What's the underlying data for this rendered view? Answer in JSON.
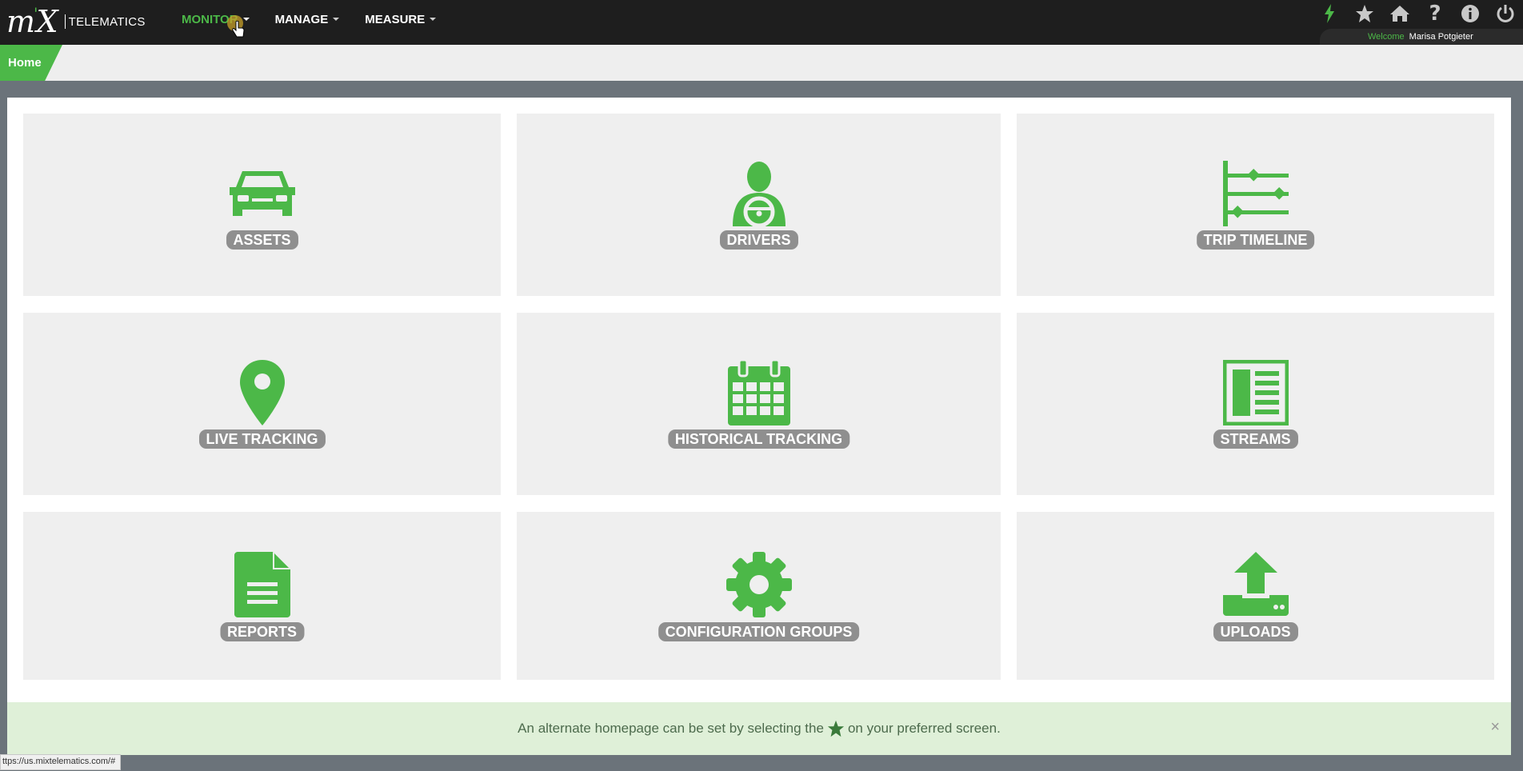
{
  "brand": {
    "logo": "m X",
    "product": "TELEMATICS"
  },
  "nav": {
    "menu": [
      {
        "label": "MONITOR",
        "active": true
      },
      {
        "label": "MANAGE",
        "active": false
      },
      {
        "label": "MEASURE",
        "active": false
      }
    ],
    "tools": [
      "bolt-icon",
      "star-icon",
      "home-icon",
      "help-icon",
      "info-icon",
      "power-icon"
    ],
    "welcome_label": "Welcome",
    "user_name": "Marisa Potgieter"
  },
  "breadcrumb": {
    "home": "Home"
  },
  "tiles": [
    {
      "label": "ASSETS",
      "icon": "car-icon"
    },
    {
      "label": "DRIVERS",
      "icon": "driver-icon"
    },
    {
      "label": "TRIP TIMELINE",
      "icon": "timeline-icon"
    },
    {
      "label": "LIVE TRACKING",
      "icon": "map-pin-icon"
    },
    {
      "label": "HISTORICAL TRACKING",
      "icon": "calendar-icon"
    },
    {
      "label": "STREAMS",
      "icon": "streams-icon"
    },
    {
      "label": "REPORTS",
      "icon": "document-icon"
    },
    {
      "label": "CONFIGURATION GROUPS",
      "icon": "gear-icon"
    },
    {
      "label": "UPLOADS",
      "icon": "upload-icon"
    }
  ],
  "notice": {
    "before": "An alternate homepage can be set by selecting the",
    "after": "on your preferred screen.",
    "close": "×"
  },
  "status_url": "ttps://us.mixtelematics.com/#",
  "colors": {
    "accent": "#4cb848",
    "navbar": "#1e1e1e",
    "tile": "#efefef",
    "label": "#8f8f8f"
  }
}
